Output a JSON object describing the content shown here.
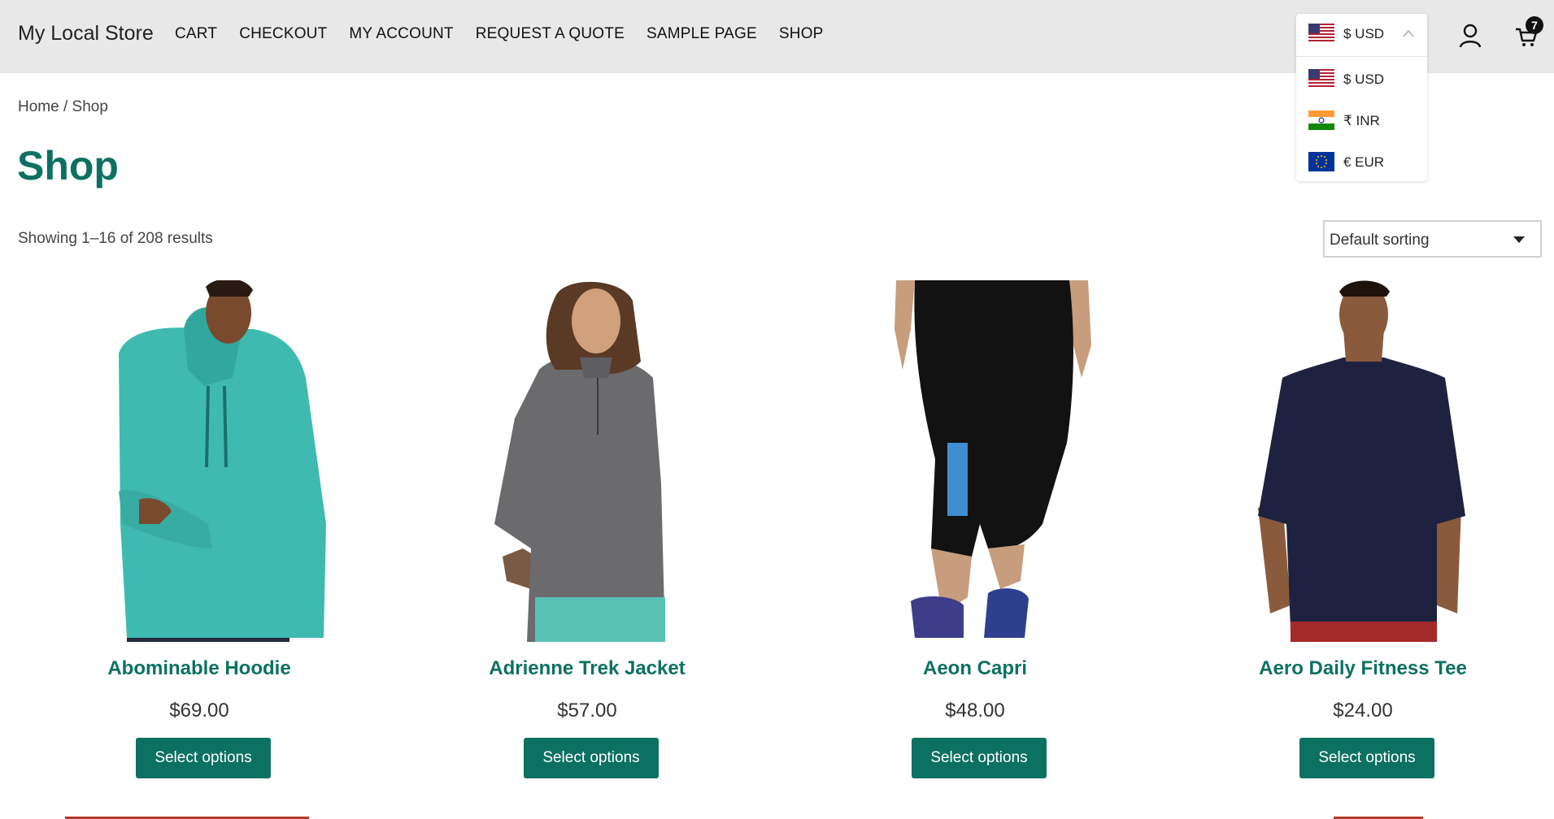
{
  "header": {
    "site_title": "My Local Store",
    "nav": [
      "CART",
      "CHECKOUT",
      "MY ACCOUNT",
      "REQUEST A QUOTE",
      "SAMPLE PAGE",
      "SHOP"
    ],
    "cart_count": "7"
  },
  "currency": {
    "current": "$ USD",
    "options": [
      "$ USD",
      "₹ INR",
      "€ EUR"
    ]
  },
  "breadcrumb": {
    "home": "Home",
    "separator": " / ",
    "current": "Shop"
  },
  "page_title": "Shop",
  "result_count": "Showing 1–16 of 208 results",
  "sorting": {
    "selected": "Default sorting"
  },
  "products": [
    {
      "name": "Abominable Hoodie",
      "price": "$69.00",
      "button": "Select options"
    },
    {
      "name": "Adrienne Trek Jacket",
      "price": "$57.00",
      "button": "Select options"
    },
    {
      "name": "Aeon Capri",
      "price": "$48.00",
      "button": "Select options"
    },
    {
      "name": "Aero Daily Fitness Tee",
      "price": "$24.00",
      "button": "Select options"
    }
  ],
  "colors": {
    "accent": "#0d7161",
    "header_bg": "#e8e8e8"
  }
}
